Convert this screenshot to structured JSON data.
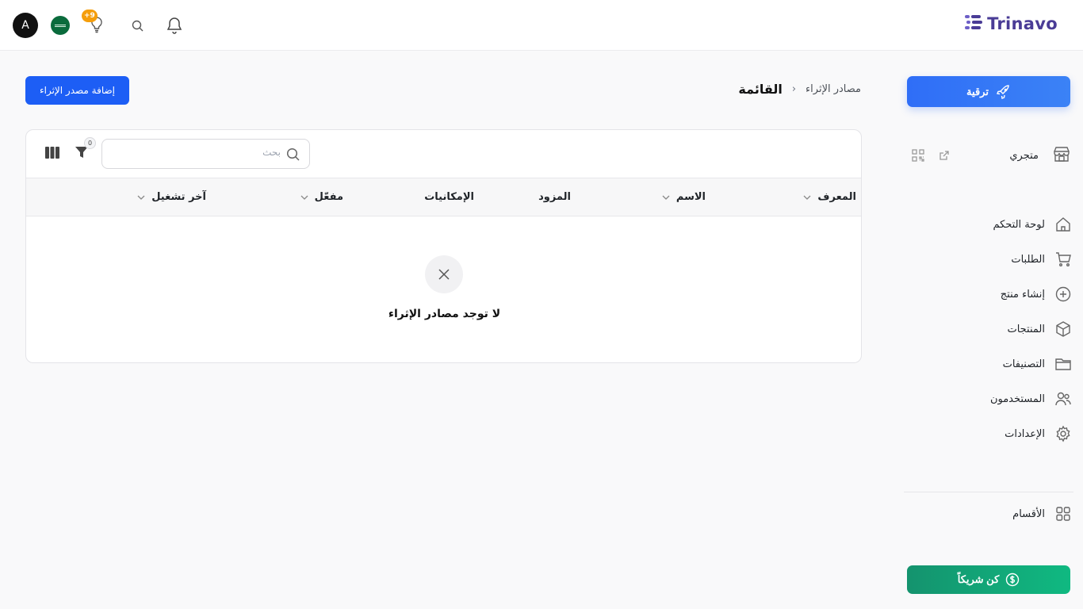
{
  "header": {
    "brand": "Trinavo",
    "avatar_letter": "A",
    "notifications_badge": "+9"
  },
  "sidebar": {
    "upgrade_label": "ترقية",
    "store_label": "متجري",
    "items": [
      {
        "label": "لوحة التحكم",
        "icon": "home-icon"
      },
      {
        "label": "الطلبات",
        "icon": "cart-icon"
      },
      {
        "label": "إنشاء منتج",
        "icon": "plus-circle-icon"
      },
      {
        "label": "المنتجات",
        "icon": "box-icon"
      },
      {
        "label": "التصنيفات",
        "icon": "folder-icon"
      },
      {
        "label": "المستخدمون",
        "icon": "users-icon"
      },
      {
        "label": "الإعدادات",
        "icon": "gear-icon"
      }
    ],
    "sections_label": "الأقسام",
    "partner_label": "كن شريكاً"
  },
  "breadcrumb": {
    "parent": "مصادر الإثراء",
    "separator": "›",
    "current": "القائمة"
  },
  "main": {
    "add_button": "إضافة مصدر الإثراء",
    "search_placeholder": "بحث",
    "filter_count": "0",
    "columns": {
      "id": "المعرف",
      "name": "الاسم",
      "provider": "المزود",
      "capabilities": "الإمكانيات",
      "enabled": "مفعّل",
      "last_run": "آخر تشغيل"
    },
    "empty_message": "لا توجد مصادر الإثراء"
  },
  "colors": {
    "primary": "#1d5ef5",
    "brand": "#4a3c96",
    "partner": "#10b981",
    "badge": "#f59e0b"
  }
}
